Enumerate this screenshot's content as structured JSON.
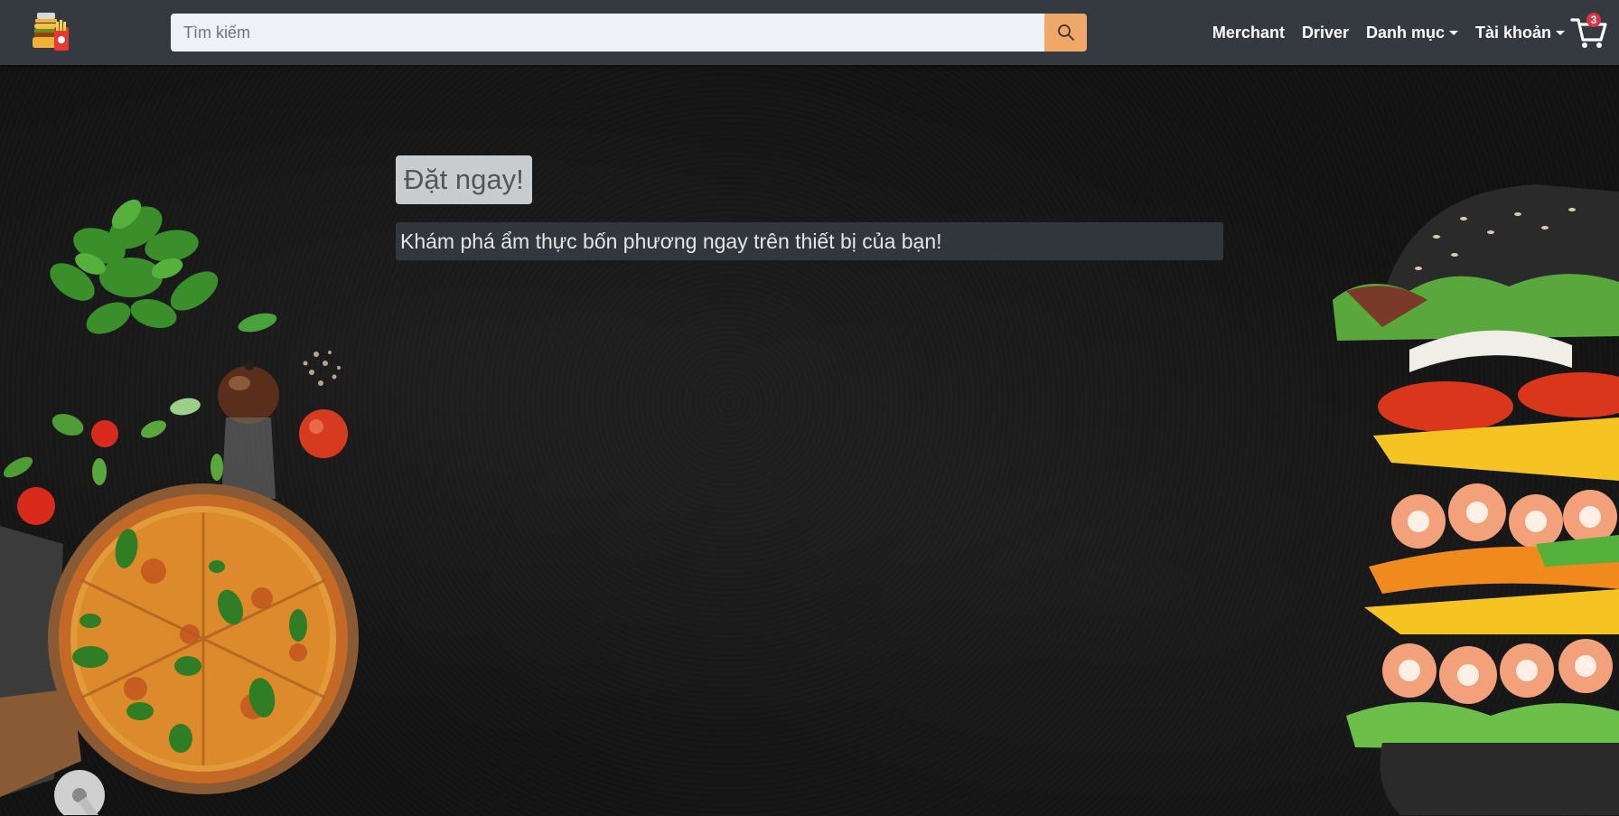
{
  "search": {
    "placeholder": "Tìm kiếm"
  },
  "nav": {
    "merchant": "Merchant",
    "driver": "Driver",
    "category": "Danh mục",
    "account": "Tài khoản"
  },
  "cart": {
    "count": "3"
  },
  "hero": {
    "order_button": "Đặt ngay!",
    "tagline": "Khám phá ẩm thực bốn phương ngay trên thiết bị của bạn!"
  },
  "colors": {
    "navbar": "#343a40",
    "search_button": "#f0a868",
    "badge": "#dc3545"
  }
}
